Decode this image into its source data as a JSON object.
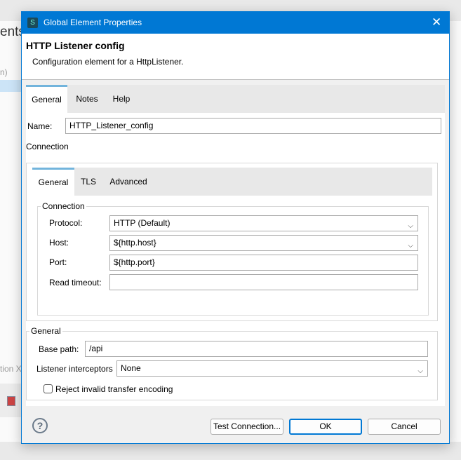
{
  "background": {
    "fragment_top": "ents",
    "fragment_mid": "n)",
    "fragment_bottom": "tion X"
  },
  "dialog": {
    "title": "Global Element Properties",
    "heading": "HTTP Listener config",
    "description": "Configuration element for a HttpListener.",
    "tabs": [
      {
        "label": "General",
        "active": true
      },
      {
        "label": "Notes"
      },
      {
        "label": "Help"
      }
    ],
    "name_label": "Name:",
    "name_value": "HTTP_Listener_config",
    "connection_label": "Connection",
    "inner_tabs": [
      {
        "label": "General",
        "active": true
      },
      {
        "label": "TLS"
      },
      {
        "label": "Advanced"
      }
    ],
    "connection_group": {
      "legend": "Connection",
      "protocol_label": "Protocol:",
      "protocol_value": "HTTP (Default)",
      "host_label": "Host:",
      "host_value": "${http.host}",
      "port_label": "Port:",
      "port_value": "${http.port}",
      "timeout_label": "Read timeout:",
      "timeout_value": ""
    },
    "general_group": {
      "legend": "General",
      "base_path_label": "Base path:",
      "base_path_value": "/api",
      "interceptors_label": "Listener interceptors",
      "interceptors_value": "None",
      "reject_label": "Reject invalid transfer encoding",
      "reject_checked": false
    },
    "buttons": {
      "test": "Test Connection...",
      "ok": "OK",
      "cancel": "Cancel"
    },
    "accent": "#0078d4"
  }
}
